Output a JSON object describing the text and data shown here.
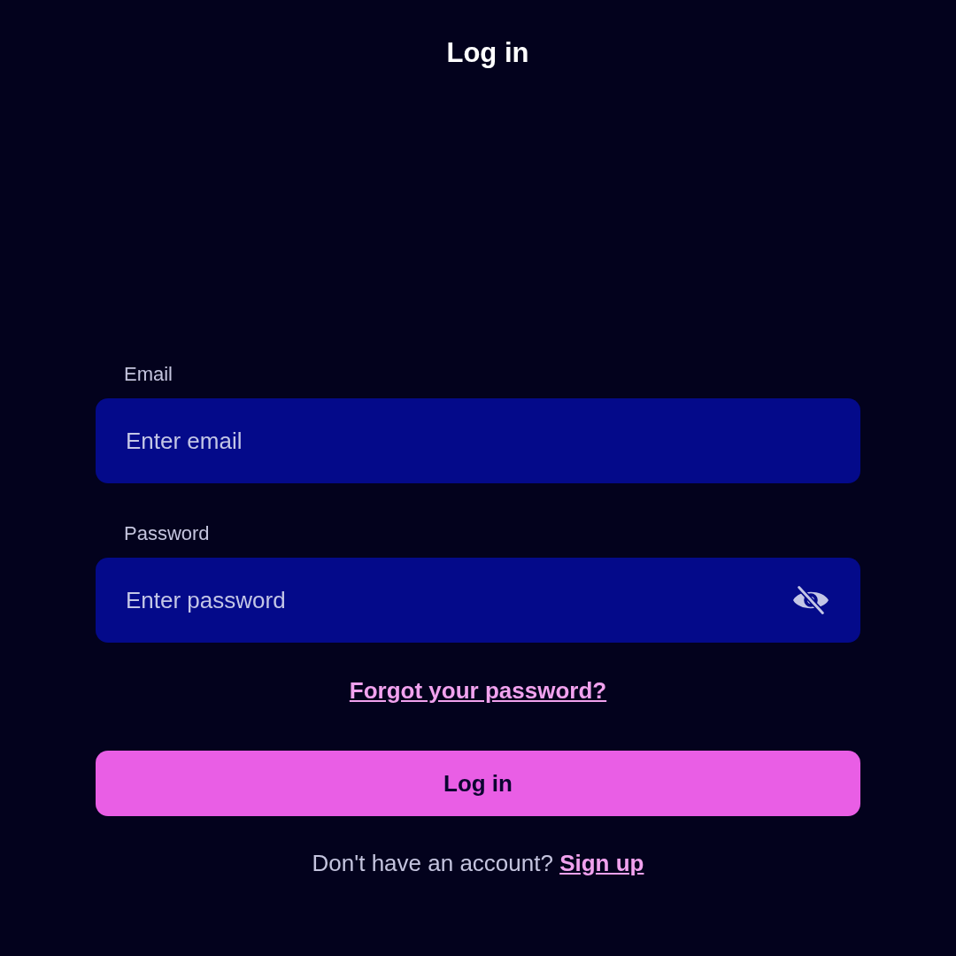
{
  "header": {
    "title": "Log in"
  },
  "fields": [
    {
      "kind": "email",
      "label": "Email",
      "placeholder": "Enter email"
    },
    {
      "kind": "password",
      "label": "Password",
      "placeholder": "Enter password",
      "show_password": false
    }
  ],
  "forgot_link": "Forgot your password?",
  "submit_button": "Log in",
  "signup": {
    "prompt": "Don't have an account?",
    "link": "Sign up"
  }
}
